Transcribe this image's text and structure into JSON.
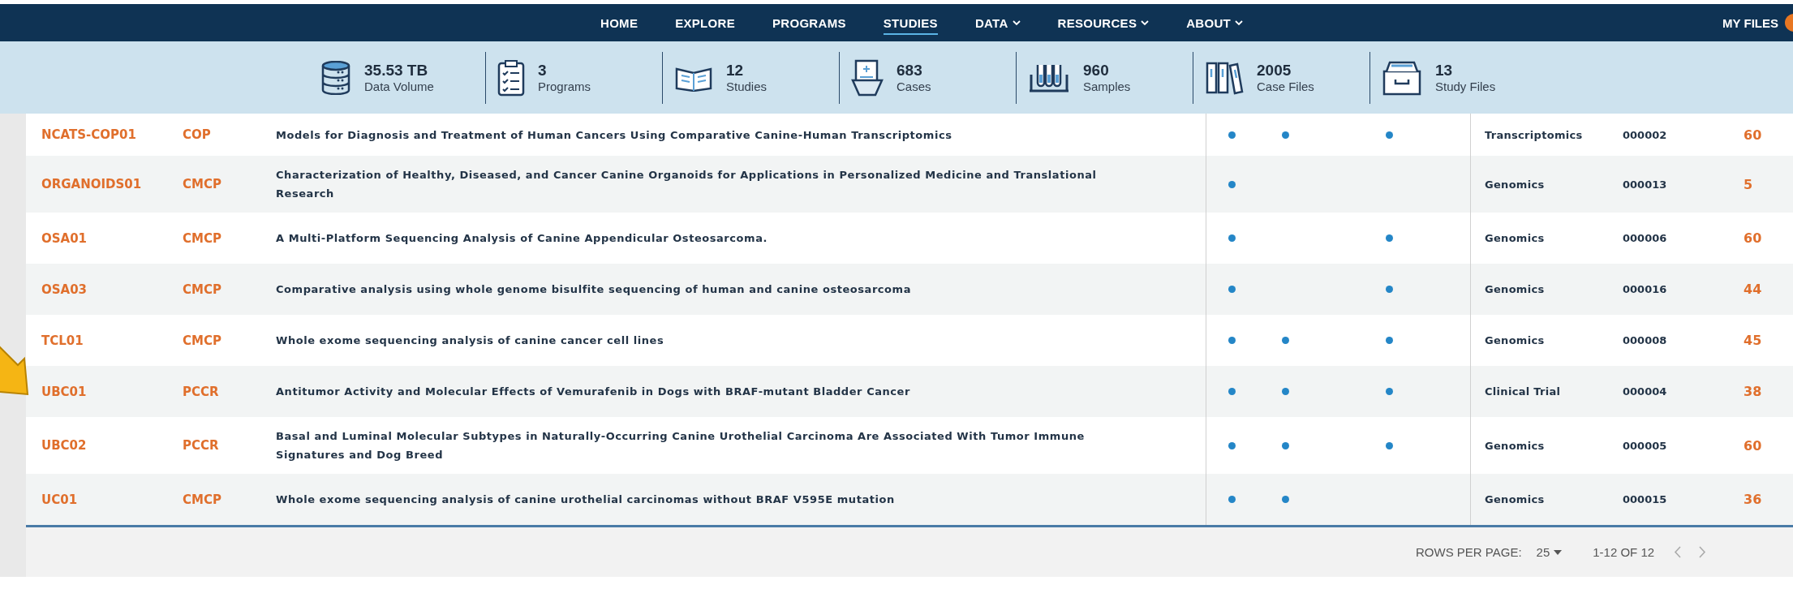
{
  "nav": {
    "items": [
      {
        "label": "HOME",
        "selected": false,
        "dropdown": false
      },
      {
        "label": "EXPLORE",
        "selected": false,
        "dropdown": false
      },
      {
        "label": "PROGRAMS",
        "selected": false,
        "dropdown": false
      },
      {
        "label": "STUDIES",
        "selected": true,
        "dropdown": false
      },
      {
        "label": "DATA",
        "selected": false,
        "dropdown": true
      },
      {
        "label": "RESOURCES",
        "selected": false,
        "dropdown": true
      },
      {
        "label": "ABOUT",
        "selected": false,
        "dropdown": true
      }
    ],
    "my_files": "MY FILES"
  },
  "stats": [
    {
      "kind": "database",
      "value": "35.53 TB",
      "label": "Data Volume"
    },
    {
      "kind": "clipboard",
      "value": "3",
      "label": "Programs"
    },
    {
      "kind": "book",
      "value": "12",
      "label": "Studies"
    },
    {
      "kind": "case",
      "value": "683",
      "label": "Cases"
    },
    {
      "kind": "tubes",
      "value": "960",
      "label": "Samples"
    },
    {
      "kind": "binders",
      "value": "2005",
      "label": "Case Files"
    },
    {
      "kind": "filebox",
      "value": "13",
      "label": "Study Files"
    }
  ],
  "table": {
    "rows": [
      {
        "study": "NCATS-COP01",
        "program": "COP",
        "title": "Models for Diagnosis and Treatment of Human Cancers Using Comparative Canine-Human Transcriptomics",
        "markers": [
          true,
          true,
          true
        ],
        "type": "Transcriptomics",
        "number": "000002",
        "cases": "60"
      },
      {
        "study": "ORGANOIDS01",
        "program": "CMCP",
        "title": "Characterization of Healthy, Diseased, and Cancer Canine Organoids for Applications in Personalized Medicine and Translational Research",
        "markers": [
          true,
          false,
          false
        ],
        "type": "Genomics",
        "number": "000013",
        "cases": "5"
      },
      {
        "study": "OSA01",
        "program": "CMCP",
        "title": "A Multi-Platform Sequencing Analysis of Canine Appendicular Osteosarcoma.",
        "markers": [
          true,
          false,
          true
        ],
        "type": "Genomics",
        "number": "000006",
        "cases": "60"
      },
      {
        "study": "OSA03",
        "program": "CMCP",
        "title": "Comparative analysis using whole genome bisulfite sequencing of human and canine osteosarcoma",
        "markers": [
          true,
          false,
          true
        ],
        "type": "Genomics",
        "number": "000016",
        "cases": "44"
      },
      {
        "study": "TCL01",
        "program": "CMCP",
        "title": "Whole exome sequencing analysis of canine cancer cell lines",
        "markers": [
          true,
          true,
          true
        ],
        "type": "Genomics",
        "number": "000008",
        "cases": "45"
      },
      {
        "study": "UBC01",
        "program": "PCCR",
        "title": "Antitumor Activity and Molecular Effects of Vemurafenib in Dogs with BRAF-mutant Bladder Cancer",
        "markers": [
          true,
          true,
          true
        ],
        "type": "Clinical Trial",
        "number": "000004",
        "cases": "38"
      },
      {
        "study": "UBC02",
        "program": "PCCR",
        "title": "Basal and Luminal Molecular Subtypes in Naturally-Occurring Canine Urothelial Carcinoma Are Associated With Tumor Immune Signatures and Dog Breed",
        "markers": [
          true,
          true,
          true
        ],
        "type": "Genomics",
        "number": "000005",
        "cases": "60"
      },
      {
        "study": "UC01",
        "program": "CMCP",
        "title": "Whole exome sequencing analysis of canine urothelial carcinomas without BRAF V595E mutation",
        "markers": [
          true,
          true,
          false
        ],
        "type": "Genomics",
        "number": "000015",
        "cases": "36"
      }
    ]
  },
  "pagination": {
    "rows_per_page_label": "ROWS PER PAGE:",
    "rows_per_page": "25",
    "range": "1-12 OF 12"
  }
}
